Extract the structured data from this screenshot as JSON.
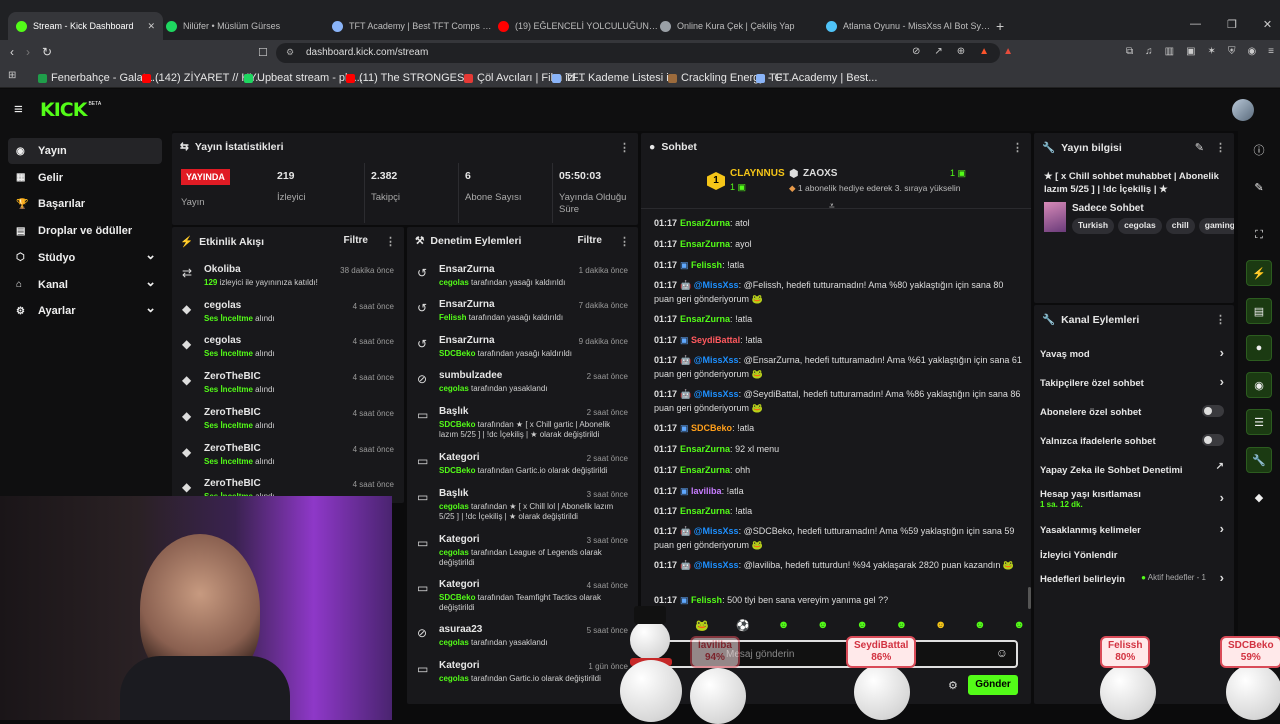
{
  "browser": {
    "tabs": [
      {
        "label": "Stream - Kick Dashboard",
        "color": "#53fc18"
      },
      {
        "label": "Nilüfer • Müslüm Gürses",
        "color": "#1ed760"
      },
      {
        "label": "TFT Academy | Best TFT Comps curat",
        "color": "#8ab4f8"
      },
      {
        "label": "(19) EĞLENCELİ YOLCULUĞUN SONU",
        "color": "#ff0000"
      },
      {
        "label": "Online Kura Çek | Çekiliş Yap",
        "color": "#9aa0a6"
      },
      {
        "label": "Atlama Oyunu - MissXss AI Bot Syste",
        "color": "#4fc3f7"
      }
    ],
    "url": "dashboard.kick.com/stream",
    "bookmarks": [
      {
        "label": "Fenerbahçe - Galata...",
        "color": "#1f9e4a"
      },
      {
        "label": "(142) ZİYARET // HY...",
        "color": "#ff0000"
      },
      {
        "label": "Upbeat stream - pla...",
        "color": "#1ed760"
      },
      {
        "label": "(11) The STRONGES...",
        "color": "#ff0000"
      },
      {
        "label": "Çöl Avcıları | Film izl...",
        "color": "#e53935"
      },
      {
        "label": "TFT Kademe Listesi i...",
        "color": "#8ab4f8"
      },
      {
        "label": "Crackling Energy - C...",
        "color": "#9c6b3c"
      },
      {
        "label": "TFT Academy | Best...",
        "color": "#8ab4f8"
      }
    ]
  },
  "kick": {
    "logo": "KICK",
    "logo_badge": "BETA",
    "nav": [
      "Yayın",
      "Gelir",
      "Başarılar",
      "Droplar ve ödüller",
      "Stüdyo",
      "Kanal",
      "Ayarlar"
    ]
  },
  "stats": {
    "title": "Yayın İstatistikleri",
    "live_label": "YAYINDA",
    "live_sub": "Yayın",
    "items": [
      {
        "value": "219",
        "label": "İzleyici"
      },
      {
        "value": "2.382",
        "label": "Takipçi"
      },
      {
        "value": "6",
        "label": "Abone Sayısı"
      },
      {
        "value": "05:50:03",
        "label": "Yayında Olduğu Süre"
      }
    ]
  },
  "activity": {
    "title": "Etkinlik Akışı",
    "filter": "Filtre",
    "rows": [
      {
        "name": "Okoliba",
        "hl": "129",
        "rest": " izleyici ile yayınınıza katıldı!",
        "time": "38 dakika önce",
        "icon": "⇄"
      },
      {
        "name": "cegolas",
        "hl": "Ses İnceltme",
        "rest": " alındı",
        "time": "4 saat önce",
        "icon": "◆"
      },
      {
        "name": "cegolas",
        "hl": "Ses İnceltme",
        "rest": " alındı",
        "time": "4 saat önce",
        "icon": "◆"
      },
      {
        "name": "ZeroTheBIC",
        "hl": "Ses İnceltme",
        "rest": " alındı",
        "time": "4 saat önce",
        "icon": "◆"
      },
      {
        "name": "ZeroTheBIC",
        "hl": "Ses İnceltme",
        "rest": " alındı",
        "time": "4 saat önce",
        "icon": "◆"
      },
      {
        "name": "ZeroTheBIC",
        "hl": "Ses İnceltme",
        "rest": " alındı",
        "time": "4 saat önce",
        "icon": "◆"
      },
      {
        "name": "ZeroTheBIC",
        "hl": "Ses İnceltme",
        "rest": " alındı",
        "time": "4 saat önce",
        "icon": "◆"
      }
    ]
  },
  "moderation": {
    "title": "Denetim Eylemleri",
    "filter": "Filtre",
    "rows": [
      {
        "name": "EnsarZurna",
        "hl": "cegolas",
        "rest": " tarafından yasağı kaldırıldı",
        "time": "1 dakika önce"
      },
      {
        "name": "EnsarZurna",
        "hl": "Felissh",
        "rest": " tarafından yasağı kaldırıldı",
        "time": "7 dakika önce"
      },
      {
        "name": "EnsarZurna",
        "hl": "SDCBeko",
        "rest": " tarafından yasağı kaldırıldı",
        "time": "9 dakika önce"
      },
      {
        "name": "sumbulzadee",
        "hl": "cegolas",
        "rest": " tarafından yasaklandı",
        "time": "2 saat önce"
      },
      {
        "name": "Başlık",
        "hl": "SDCBeko",
        "rest": " tarafından ★ [ x Chill gartic | Abonelik lazım 5/25 ] | !dc İçekiliş | ★ olarak değiştirildi",
        "time": "2 saat önce"
      },
      {
        "name": "Kategori",
        "hl": "SDCBeko",
        "rest": " tarafından Gartic.io olarak değiştirildi",
        "time": "2 saat önce"
      },
      {
        "name": "Başlık",
        "hl": "cegolas",
        "rest": " tarafından ★ [ x Chill lol | Abonelik lazım 5/25 ] | !dc İçekiliş | ★ olarak değiştirildi",
        "time": "3 saat önce"
      },
      {
        "name": "Kategori",
        "hl": "cegolas",
        "rest": " tarafından League of Legends olarak değiştirildi",
        "time": "3 saat önce"
      },
      {
        "name": "Kategori",
        "hl": "SDCBeko",
        "rest": " tarafından Teamfight Tactics olarak değiştirildi",
        "time": "4 saat önce"
      },
      {
        "name": "asuraa23",
        "hl": "cegolas",
        "rest": " tarafından yasaklandı",
        "time": "5 saat önce"
      },
      {
        "name": "Kategori",
        "hl": "cegolas",
        "rest": " tarafından Gartic.io olarak değiştirildi",
        "time": "1 gün önce"
      }
    ]
  },
  "chat": {
    "title": "Sohbet",
    "pin_user1": "CLAYNNUS",
    "pin_user1_count": "1",
    "pin_user2": "ZAOXS",
    "pin_user2_count": "1",
    "pin_text": "1 abonelik hediye ederek 3. sıraya yükselin",
    "messages": [
      {
        "time": "01:17",
        "user": "EnsarZurna",
        "color": "#53fc18",
        "text": "atol"
      },
      {
        "time": "01:17",
        "user": "EnsarZurna",
        "color": "#53fc18",
        "text": "ayol"
      },
      {
        "time": "01:17",
        "user": "Felissh",
        "color": "#53fc18",
        "text": "!atla"
      },
      {
        "time": "01:17",
        "user": "@MissXss",
        "color": "#1e90ff",
        "text": "@Felissh, hedefi tutturamadın! Ama %80 yaklaştığın için sana 80 puan geri gönderiyorum 🐸"
      },
      {
        "time": "01:17",
        "user": "EnsarZurna",
        "color": "#53fc18",
        "text": "!atla"
      },
      {
        "time": "01:17",
        "user": "SeydiBattal",
        "color": "#ff5a5f",
        "text": "!atla"
      },
      {
        "time": "01:17",
        "user": "@MissXss",
        "color": "#1e90ff",
        "text": "@EnsarZurna, hedefi tutturamadın! Ama %61 yaklaştığın için sana 61 puan geri gönderiyorum 🐸"
      },
      {
        "time": "01:17",
        "user": "@MissXss",
        "color": "#1e90ff",
        "text": "@SeydiBattal, hedefi tutturamadın! Ama %86 yaklaştığın için sana 86 puan geri gönderiyorum 🐸"
      },
      {
        "time": "01:17",
        "user": "SDCBeko",
        "color": "#ff9f1a",
        "text": "!atla"
      },
      {
        "time": "01:17",
        "user": "EnsarZurna",
        "color": "#53fc18",
        "text": "92 xl menu"
      },
      {
        "time": "01:17",
        "user": "EnsarZurna",
        "color": "#53fc18",
        "text": "ohh"
      },
      {
        "time": "01:17",
        "user": "laviliba",
        "color": "#c77dff",
        "text": "!atla"
      },
      {
        "time": "01:17",
        "user": "EnsarZurna",
        "color": "#53fc18",
        "text": "!atla"
      },
      {
        "time": "01:17",
        "user": "@MissXss",
        "color": "#1e90ff",
        "text": "@SDCBeko, hedefi tutturamadın! Ama %59 yaklaştığın için sana 59 puan geri gönderiyorum 🐸"
      },
      {
        "time": "01:17",
        "user": "@MissXss",
        "color": "#1e90ff",
        "text": "@laviliba, hedefi tutturdun! %94 yaklaşarak 2820 puan kazandın 🐸"
      },
      {
        "time": "01:17",
        "user": "Felissh",
        "color": "#53fc18",
        "text": "500 tlyi ben sana vereyim yanıma gel ??"
      }
    ],
    "input_placeholder": "Mesaj gönderin",
    "send": "Gönder"
  },
  "info": {
    "title": "Yayın bilgisi",
    "stream_title": "★ [ x Chill sohbet muhabbet | Abonelik lazım 5/25 ] | !dc İçekiliş | ★",
    "category": "Sadece Sohbet",
    "tags": [
      "Turkish",
      "cegolas",
      "chill",
      "gaming"
    ]
  },
  "channel": {
    "title": "Kanal Eylemleri",
    "items": [
      {
        "label": "Yavaş mod",
        "control": "chev"
      },
      {
        "label": "Takipçilere özel sohbet",
        "control": "chev"
      },
      {
        "label": "Abonelere özel sohbet",
        "control": "toggle"
      },
      {
        "label": "Yalnızca ifadelerle sohbet",
        "control": "toggle"
      },
      {
        "label": "Yapay Zeka ile Sohbet Denetimi",
        "control": "ext"
      },
      {
        "label": "Hesap yaşı kısıtlaması",
        "sub": "1 sa. 12 dk.",
        "control": "chev"
      },
      {
        "label": "Yasaklanmış kelimeler",
        "control": "chev"
      },
      {
        "label": "İzleyici Yönlendir",
        "control": ""
      },
      {
        "label": "Hedefleri belirleyin",
        "extra": "Aktif hedefler - 1",
        "control": "chev"
      }
    ]
  },
  "overlay": {
    "bubbles": [
      {
        "name": "laviliba",
        "pct": "94%"
      },
      {
        "name": "SeydiBattal",
        "pct": "86%"
      },
      {
        "name": "Felissh",
        "pct": "80%"
      },
      {
        "name": "SDCBeko",
        "pct": "59%"
      }
    ]
  }
}
